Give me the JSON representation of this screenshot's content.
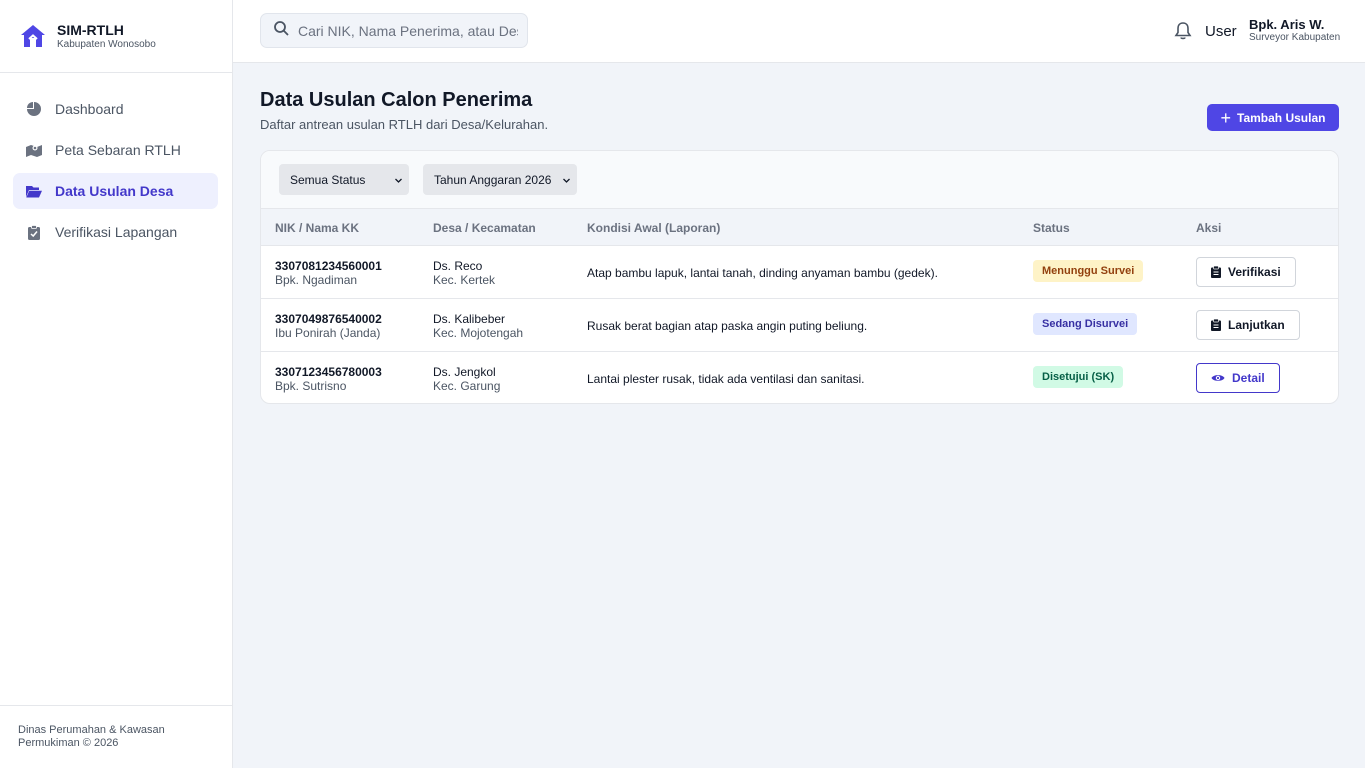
{
  "brand": {
    "title": "SIM-RTLH",
    "subtitle": "Kabupaten Wonosobo",
    "icon": "home-icon"
  },
  "sidebar": {
    "items": [
      {
        "label": "Dashboard",
        "icon": "pie-chart-icon",
        "active": false
      },
      {
        "label": "Peta Sebaran RTLH",
        "icon": "map-icon",
        "active": false
      },
      {
        "label": "Data Usulan Desa",
        "icon": "folder-open-icon",
        "active": true
      },
      {
        "label": "Verifikasi Lapangan",
        "icon": "clipboard-check-icon",
        "active": false
      }
    ],
    "footer": "Dinas Perumahan & Kawasan Permukiman © 2026"
  },
  "topbar": {
    "search_placeholder": "Cari NIK, Nama Penerima, atau Desa...",
    "user_label": "User",
    "user_name": "Bpk. Aris W.",
    "user_role": "Surveyor Kabupaten"
  },
  "page": {
    "title": "Data Usulan Calon Penerima",
    "subtitle": "Daftar antrean usulan RTLH dari Desa/Kelurahan.",
    "add_button": "Tambah Usulan"
  },
  "filters": {
    "status": "Semua Status",
    "year": "Tahun Anggaran 2026"
  },
  "table": {
    "headers": [
      "NIK / Nama KK",
      "Desa / Kecamatan",
      "Kondisi Awal (Laporan)",
      "Status",
      "Aksi"
    ],
    "rows": [
      {
        "nik": "3307081234560001",
        "name": "Bpk. Ngadiman",
        "desa": "Ds. Reco",
        "kec": "Kec. Kertek",
        "kondisi": "Atap bambu lapuk, lantai tanah, dinding anyaman bambu (gedek).",
        "status": "Menunggu Survei",
        "action": "Verifikasi"
      },
      {
        "nik": "3307049876540002",
        "name": "Ibu Ponirah (Janda)",
        "desa": "Ds. Kalibeber",
        "kec": "Kec. Mojotengah",
        "kondisi": "Rusak berat bagian atap paska angin puting beliung.",
        "status": "Sedang Disurvei",
        "action": "Lanjutkan"
      },
      {
        "nik": "3307123456780003",
        "name": "Bpk. Sutrisno",
        "desa": "Ds. Jengkol",
        "kec": "Kec. Garung",
        "kondisi": "Lantai plester rusak, tidak ada ventilasi dan sanitasi.",
        "status": "Disetujui (SK)",
        "action": "Detail"
      }
    ]
  },
  "colors": {
    "accent": "#4f46e5",
    "active_bg": "#eef0fe",
    "page_bg": "#f1f4f9"
  }
}
